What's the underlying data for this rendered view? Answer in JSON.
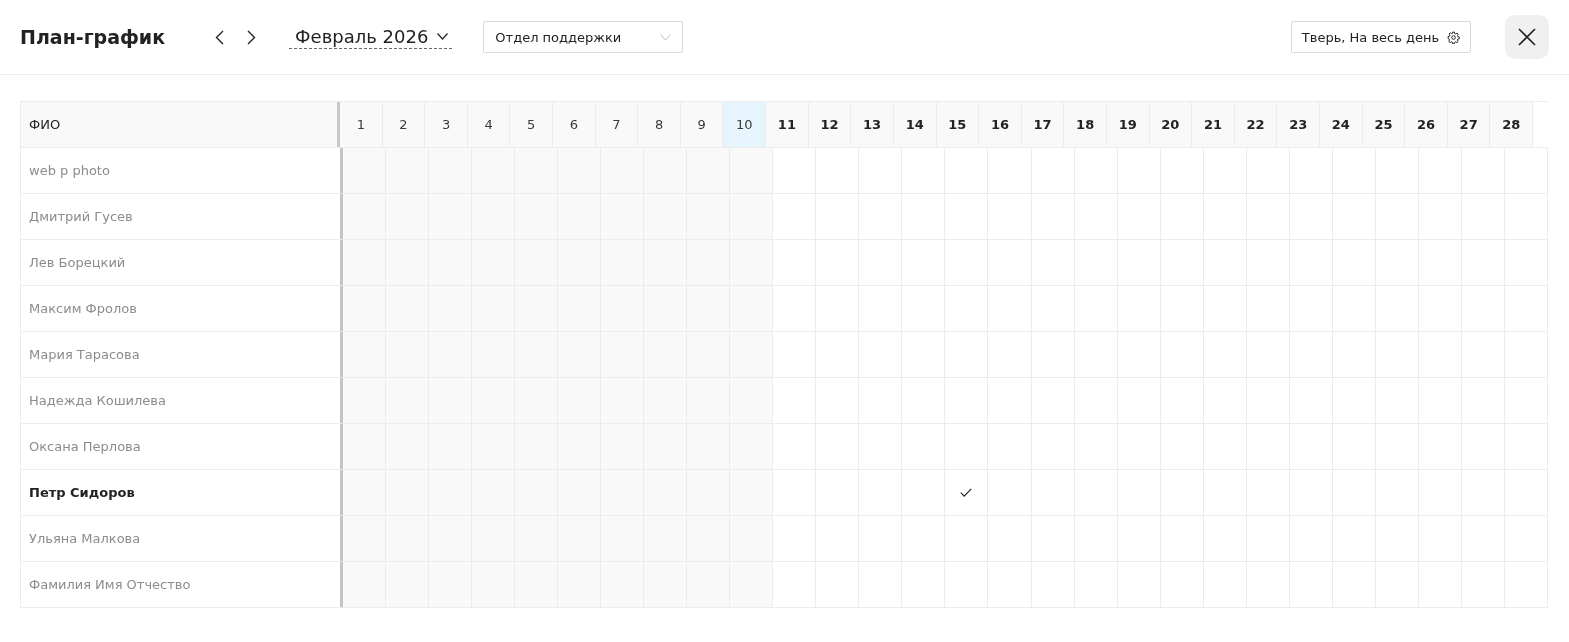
{
  "header": {
    "title": "План-график",
    "month": "Февраль 2026",
    "department": "Отдел поддержки",
    "settings": "Тверь, На весь день"
  },
  "table": {
    "name_column": "ФИО",
    "days": [
      {
        "label": "1",
        "past": true,
        "today": false
      },
      {
        "label": "2",
        "past": true,
        "today": false
      },
      {
        "label": "3",
        "past": true,
        "today": false
      },
      {
        "label": "4",
        "past": true,
        "today": false
      },
      {
        "label": "5",
        "past": true,
        "today": false
      },
      {
        "label": "6",
        "past": true,
        "today": false
      },
      {
        "label": "7",
        "past": true,
        "today": false
      },
      {
        "label": "8",
        "past": true,
        "today": false
      },
      {
        "label": "9",
        "past": true,
        "today": false
      },
      {
        "label": "10",
        "past": true,
        "today": true
      },
      {
        "label": "11",
        "past": false,
        "today": false
      },
      {
        "label": "12",
        "past": false,
        "today": false
      },
      {
        "label": "13",
        "past": false,
        "today": false
      },
      {
        "label": "14",
        "past": false,
        "today": false
      },
      {
        "label": "15",
        "past": false,
        "today": false
      },
      {
        "label": "16",
        "past": false,
        "today": false
      },
      {
        "label": "17",
        "past": false,
        "today": false
      },
      {
        "label": "18",
        "past": false,
        "today": false
      },
      {
        "label": "19",
        "past": false,
        "today": false
      },
      {
        "label": "20",
        "past": false,
        "today": false
      },
      {
        "label": "21",
        "past": false,
        "today": false
      },
      {
        "label": "22",
        "past": false,
        "today": false
      },
      {
        "label": "23",
        "past": false,
        "today": false
      },
      {
        "label": "24",
        "past": false,
        "today": false
      },
      {
        "label": "25",
        "past": false,
        "today": false
      },
      {
        "label": "26",
        "past": false,
        "today": false
      },
      {
        "label": "27",
        "past": false,
        "today": false
      },
      {
        "label": "28",
        "past": false,
        "today": false
      }
    ],
    "rows": [
      {
        "name": "web p photo",
        "current": false,
        "checks": [
          false,
          false,
          false,
          false,
          false,
          false,
          false,
          false,
          false,
          false,
          false,
          false,
          false,
          false,
          false,
          false,
          false,
          false,
          false,
          false,
          false,
          false,
          false,
          false,
          false,
          false,
          false,
          false
        ]
      },
      {
        "name": "Дмитрий Гусев",
        "current": false,
        "checks": [
          false,
          false,
          false,
          false,
          false,
          false,
          false,
          false,
          false,
          false,
          false,
          false,
          false,
          false,
          false,
          false,
          false,
          false,
          false,
          false,
          false,
          false,
          false,
          false,
          false,
          false,
          false,
          false
        ]
      },
      {
        "name": "Лев Борецкий",
        "current": false,
        "checks": [
          false,
          false,
          false,
          false,
          false,
          false,
          false,
          false,
          false,
          false,
          false,
          false,
          false,
          false,
          false,
          false,
          false,
          false,
          false,
          false,
          false,
          false,
          false,
          false,
          false,
          false,
          false,
          false
        ]
      },
      {
        "name": "Максим Фролов",
        "current": false,
        "checks": [
          false,
          false,
          false,
          false,
          false,
          false,
          false,
          false,
          false,
          false,
          false,
          false,
          false,
          false,
          false,
          false,
          false,
          false,
          false,
          false,
          false,
          false,
          false,
          false,
          false,
          false,
          false,
          false
        ]
      },
      {
        "name": "Мария Тарасова",
        "current": false,
        "checks": [
          false,
          false,
          false,
          false,
          false,
          false,
          false,
          false,
          false,
          false,
          false,
          false,
          false,
          false,
          false,
          false,
          false,
          false,
          false,
          false,
          false,
          false,
          false,
          false,
          false,
          false,
          false,
          false
        ]
      },
      {
        "name": "Надежда Кошилева",
        "current": false,
        "checks": [
          false,
          false,
          false,
          false,
          false,
          false,
          false,
          false,
          false,
          false,
          false,
          false,
          false,
          false,
          false,
          false,
          false,
          false,
          false,
          false,
          false,
          false,
          false,
          false,
          false,
          false,
          false,
          false
        ]
      },
      {
        "name": "Оксана Перлова",
        "current": false,
        "checks": [
          false,
          false,
          false,
          false,
          false,
          false,
          false,
          false,
          false,
          false,
          false,
          false,
          false,
          false,
          false,
          false,
          false,
          false,
          false,
          false,
          false,
          false,
          false,
          false,
          false,
          false,
          false,
          false
        ]
      },
      {
        "name": "Петр Сидоров",
        "current": true,
        "checks": [
          false,
          false,
          false,
          false,
          false,
          false,
          false,
          false,
          false,
          false,
          false,
          false,
          false,
          false,
          true,
          false,
          false,
          false,
          false,
          false,
          false,
          false,
          false,
          false,
          false,
          false,
          false,
          false
        ]
      },
      {
        "name": "Ульяна Малкова",
        "current": false,
        "checks": [
          false,
          false,
          false,
          false,
          false,
          false,
          false,
          false,
          false,
          false,
          false,
          false,
          false,
          false,
          false,
          false,
          false,
          false,
          false,
          false,
          false,
          false,
          false,
          false,
          false,
          false,
          false,
          false
        ]
      },
      {
        "name": "Фамилия Имя Отчество",
        "current": false,
        "checks": [
          false,
          false,
          false,
          false,
          false,
          false,
          false,
          false,
          false,
          false,
          false,
          false,
          false,
          false,
          false,
          false,
          false,
          false,
          false,
          false,
          false,
          false,
          false,
          false,
          false,
          false,
          false,
          false
        ]
      }
    ]
  }
}
